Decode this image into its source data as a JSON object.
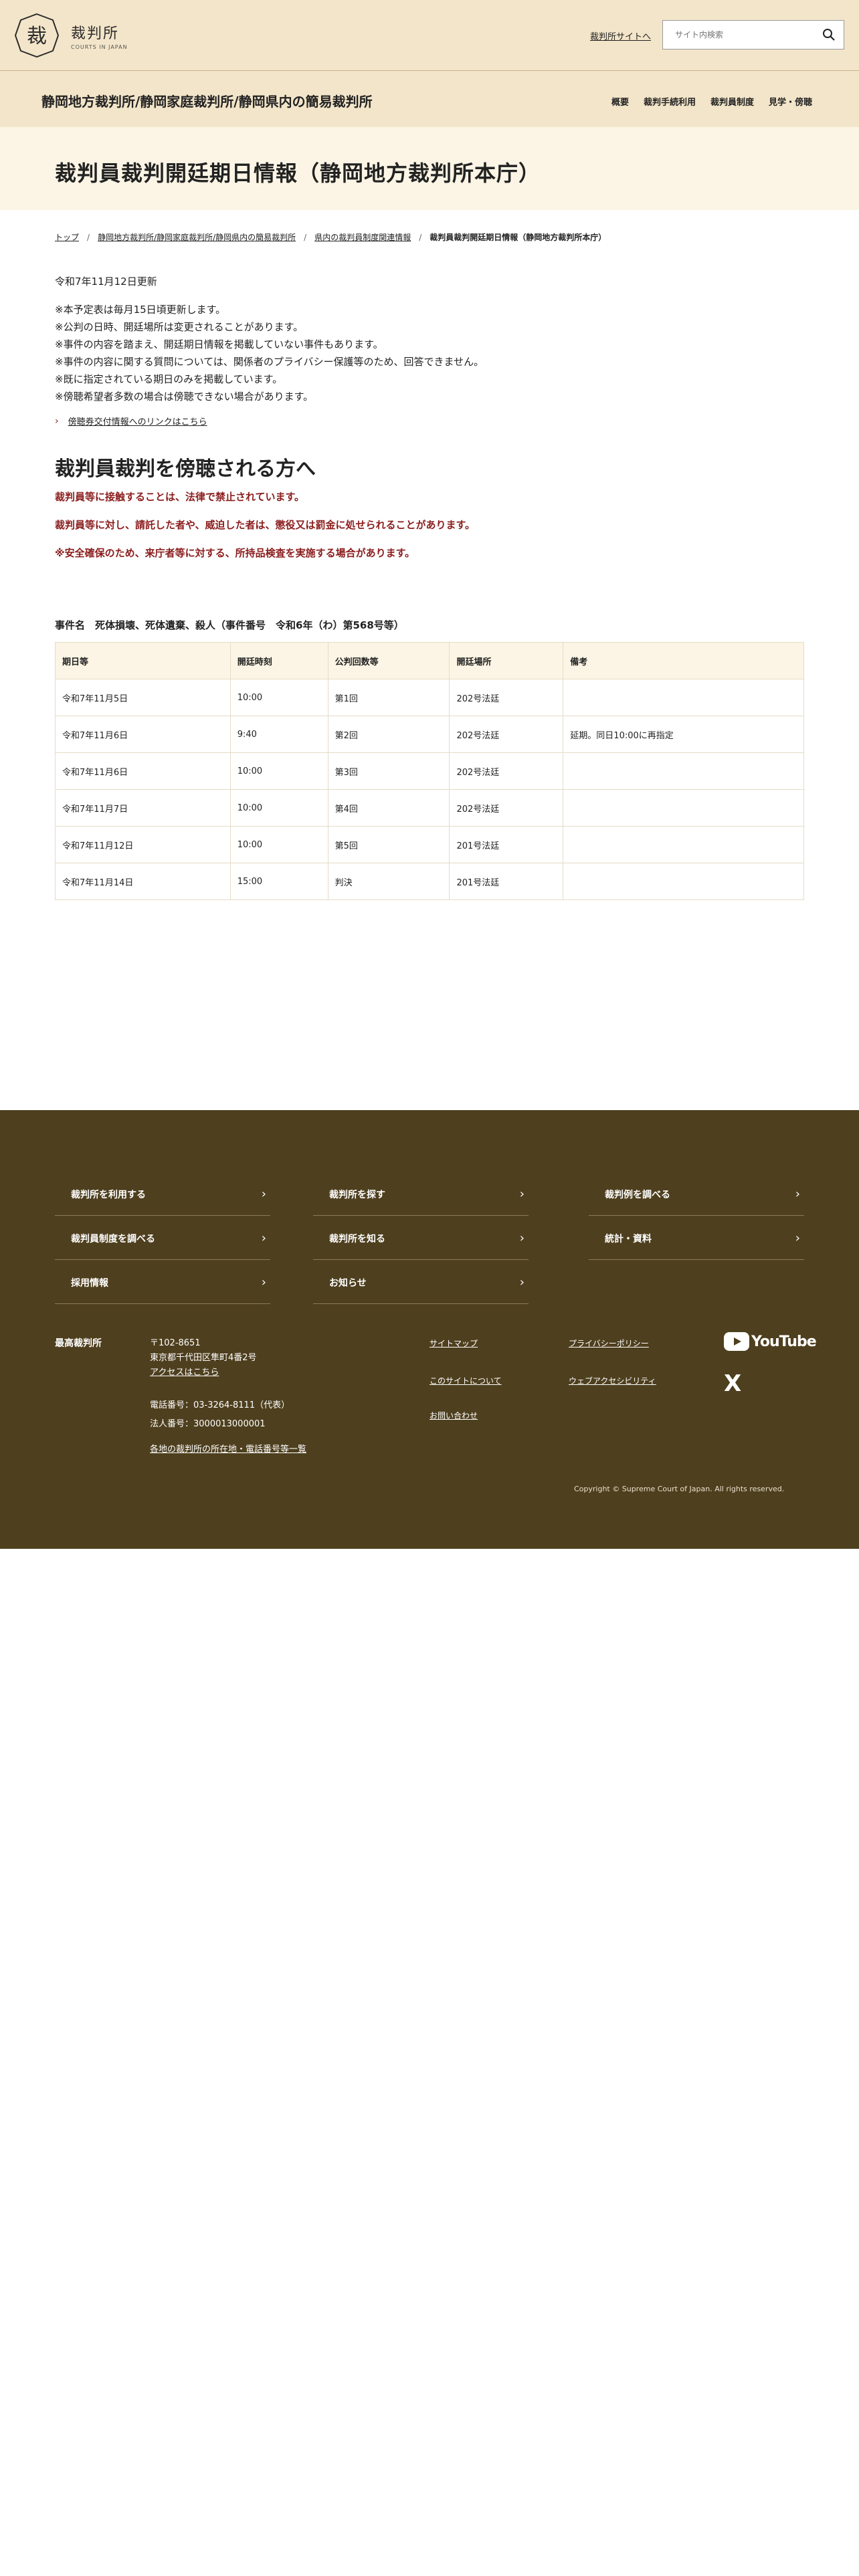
{
  "header": {
    "logo_text": "裁判所",
    "logo_sub": "COURTS IN JAPAN",
    "logo_mark_char": "裁",
    "site_link": "裁判所サイトへ",
    "search_placeholder": "サイト内検索"
  },
  "site_nav": {
    "title": "静岡地方裁判所/静岡家庭裁判所/静岡県内の簡易裁判所",
    "links": [
      "概要",
      "裁判手続利用",
      "裁判員制度",
      "見学・傍聴"
    ]
  },
  "page_title": "裁判員裁判開廷期日情報（静岡地方裁判所本庁）",
  "breadcrumb": [
    "トップ",
    "静岡地方裁判所/静岡家庭裁判所/静岡県内の簡易裁判所",
    "県内の裁判員制度関連情報",
    "裁判員裁判開廷期日情報（静岡地方裁判所本庁）"
  ],
  "updated": "令和7年11月12日更新",
  "notes": [
    "※本予定表は毎月15日頃更新します。",
    "※公判の日時、開廷場所は変更されることがあります。",
    "※事件の内容を踏まえ、開廷期日情報を掲載していない事件もあります。",
    "※事件の内容に関する質問については、関係者のプライバシー保護等のため、回答できません。",
    "※既に指定されている期日のみを掲載しています。",
    "※傍聴希望者多数の場合は傍聴できない場合があります。"
  ],
  "related_link": "傍聴券交付情報へのリンクはこちら",
  "section_title": "裁判員裁判を傍聴される方へ",
  "warnings": [
    "裁判員等に接触することは、法律で禁止されています。",
    "裁判員等に対し、請託した者や、威迫した者は、懲役又は罰金に処せられることがあります。",
    "※安全確保のため、来庁者等に対する、所持品検査を実施する場合があります。"
  ],
  "case_name": "事件名　死体損壊、死体遺棄、殺人（事件番号　令和6年（わ）第568号等）",
  "table": {
    "headers": [
      "期日等",
      "開廷時刻",
      "公判回数等",
      "開廷場所",
      "備考"
    ],
    "rows": [
      [
        "令和7年11月5日",
        "10:00",
        "第1回",
        "202号法廷",
        ""
      ],
      [
        "令和7年11月6日",
        "9:40",
        "第2回",
        "202号法廷",
        "延期。同日10:00に再指定"
      ],
      [
        "令和7年11月6日",
        "10:00",
        "第3回",
        "202号法廷",
        ""
      ],
      [
        "令和7年11月7日",
        "10:00",
        "第4回",
        "202号法廷",
        ""
      ],
      [
        "令和7年11月12日",
        "10:00",
        "第5回",
        "201号法廷",
        ""
      ],
      [
        "令和7年11月14日",
        "15:00",
        "判決",
        "201号法廷",
        ""
      ]
    ]
  },
  "footer": {
    "nav": [
      "裁判所を利用する",
      "裁判所を探す",
      "裁判例を調べる",
      "裁判員制度を調べる",
      "裁判所を知る",
      "統計・資料",
      "採用情報",
      "お知らせ"
    ],
    "org": "最高裁判所",
    "address": [
      "〒102-8651",
      "東京都千代田区隼町4番2号"
    ],
    "access": "アクセスはこちら",
    "phone": "電話番号：03-3264-8111（代表）",
    "corp_no": "法人番号：3000013000001",
    "courts_list": "各地の裁判所の所在地・電話番号等一覧",
    "links": [
      "サイトマップ",
      "このサイトについて",
      "お問い合わせ",
      "プライバシーポリシー",
      "ウェブアクセシビリティ"
    ],
    "youtube": "YouTube",
    "x": "X",
    "copyright": "Copyright © Supreme Court of Japan. All rights reserved."
  }
}
